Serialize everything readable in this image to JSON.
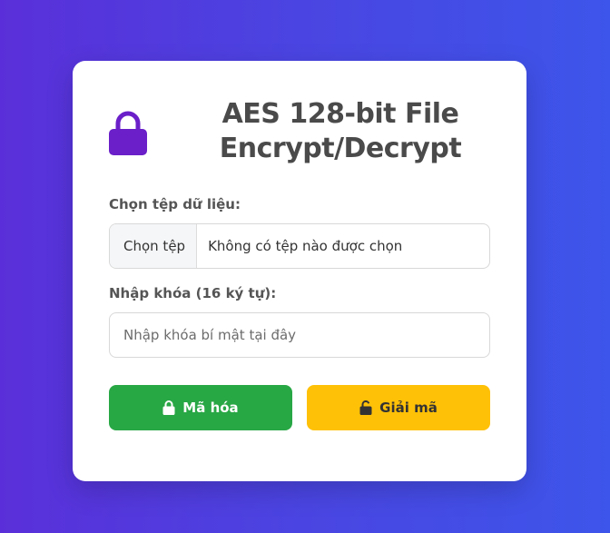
{
  "colors": {
    "accent_purple": "#6a1fc9",
    "encrypt_green": "#28a745",
    "decrypt_yellow": "#ffc107"
  },
  "header": {
    "icon": "lock-icon",
    "title": "AES 128-bit File Encrypt/Decrypt"
  },
  "file_field": {
    "label": "Chọn tệp dữ liệu:",
    "button_label": "Chọn tệp",
    "status": "Không có tệp nào được chọn"
  },
  "key_field": {
    "label": "Nhập khóa (16 ký tự):",
    "value": "",
    "placeholder": "Nhập khóa bí mật tại đây"
  },
  "actions": {
    "encrypt_label": "Mã hóa",
    "encrypt_icon": "lock-icon",
    "decrypt_label": "Giải mã",
    "decrypt_icon": "unlock-icon"
  }
}
